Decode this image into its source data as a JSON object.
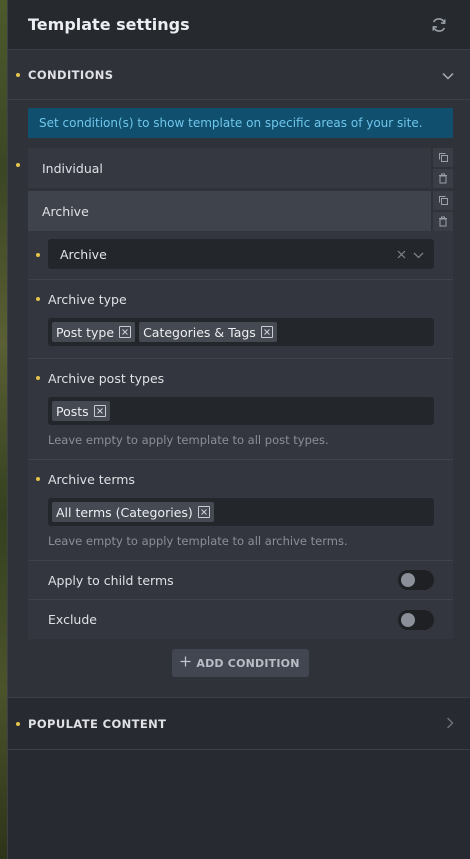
{
  "header": {
    "title": "Template settings"
  },
  "conditions": {
    "section_label": "CONDITIONS",
    "info": "Set condition(s) to show template on specific areas of your site.",
    "items": [
      {
        "label": "Individual"
      },
      {
        "label": "Archive"
      }
    ],
    "archive": {
      "select_value": "Archive",
      "archive_type": {
        "label": "Archive type",
        "tags": [
          "Post type",
          "Categories & Tags"
        ]
      },
      "post_types": {
        "label": "Archive post types",
        "tags": [
          "Posts"
        ],
        "help": "Leave empty to apply template to all post types."
      },
      "terms": {
        "label": "Archive terms",
        "tags": [
          "All terms (Categories)"
        ],
        "help": "Leave empty to apply template to all archive terms."
      },
      "child_terms": {
        "label": "Apply to child terms",
        "on": false
      },
      "exclude": {
        "label": "Exclude",
        "on": false
      }
    },
    "add_button": "ADD CONDITION"
  },
  "populate": {
    "label": "POPULATE CONTENT"
  },
  "colors": {
    "accent_dot": "#e4c34a",
    "info_bg": "#10506e",
    "info_text": "#6fc6ec"
  },
  "icons": {
    "refresh": "refresh-icon",
    "collapse": "chevron-down-icon",
    "expand": "chevron-right-icon",
    "duplicate": "duplicate-icon",
    "delete": "trash-icon",
    "clear": "close-icon",
    "tag_remove": "close-box-icon",
    "add": "plus-icon"
  }
}
